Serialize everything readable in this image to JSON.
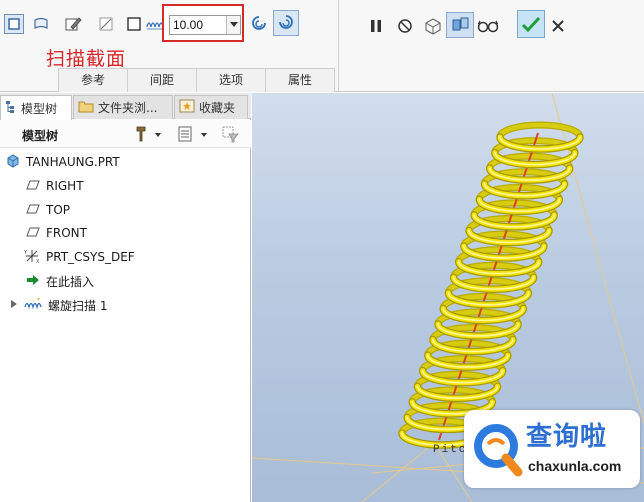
{
  "dashboard": {
    "pitch_value": "10.00",
    "tabs": [
      "参考",
      "间距",
      "选项",
      "属性"
    ],
    "annotation": "扫描截面"
  },
  "navigator": {
    "tabs": [
      {
        "label": "模型树",
        "icon": "model-tree-icon"
      },
      {
        "label": "文件夹浏...",
        "icon": "folder-browser-icon"
      },
      {
        "label": "收藏夹",
        "icon": "favorites-icon"
      }
    ],
    "toolbar_title": "模型树",
    "tree": [
      {
        "label": "TANHAUNG.PRT",
        "icon": "part-icon"
      },
      {
        "label": "RIGHT",
        "icon": "datum-plane-icon"
      },
      {
        "label": "TOP",
        "icon": "datum-plane-icon"
      },
      {
        "label": "FRONT",
        "icon": "datum-plane-icon"
      },
      {
        "label": "PRT_CSYS_DEF",
        "icon": "csys-icon"
      },
      {
        "label": "在此插入",
        "icon": "insert-here-arrow-icon"
      },
      {
        "label": "螺旋扫描 1",
        "icon": "helical-sweep-icon"
      }
    ]
  },
  "viewport": {
    "label": "Pitch",
    "spring_color": "#f2e300",
    "axis_color": "#d8402a"
  },
  "watermark": {
    "text": "查询啦",
    "url": "chaxunla.com"
  }
}
